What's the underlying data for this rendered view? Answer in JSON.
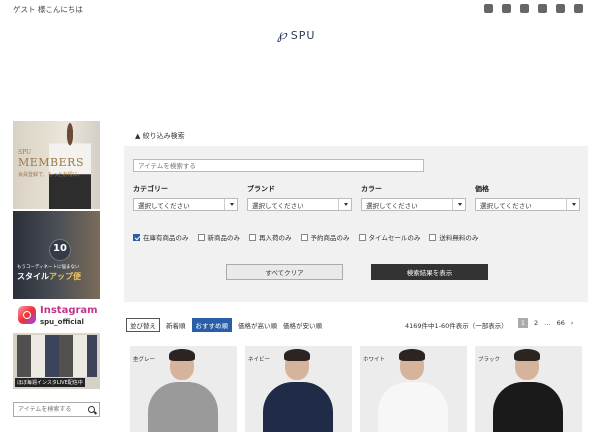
{
  "header": {
    "greeting": "ゲスト 様こんにちは",
    "logo_mark": "℘",
    "logo_text": "SPU",
    "social_icons": [
      "mail-icon",
      "twitter-icon",
      "instagram-icon",
      "line-icon",
      "youtube-icon",
      "facebook-icon"
    ]
  },
  "sidebar": {
    "members": {
      "small": "SPU",
      "title": "MEMBERS",
      "caption": "会員登録で、もっとお得に。"
    },
    "styleup": {
      "number": "10",
      "sub": "もうコーディネートに悩まない",
      "title_pre": "スタイル",
      "title_em": "アップ便"
    },
    "instagram": {
      "title": "Instagram",
      "handle": "spu_official",
      "caption": "ほぼ毎週インスタLIVE配信中"
    },
    "search_placeholder": "アイテムを検索する"
  },
  "filter": {
    "toggle_label": "▲ 絞り込み検索",
    "keyword_placeholder": "アイテムを検索する",
    "groups": [
      {
        "label": "カテゴリー",
        "value": "選択してください"
      },
      {
        "label": "ブランド",
        "value": "選択してください"
      },
      {
        "label": "カラー",
        "value": "選択してください"
      },
      {
        "label": "価格",
        "value": "選択してください"
      }
    ],
    "checkboxes": [
      {
        "label": "在庫有商品のみ",
        "checked": true
      },
      {
        "label": "新商品のみ",
        "checked": false
      },
      {
        "label": "再入荷のみ",
        "checked": false
      },
      {
        "label": "予約商品のみ",
        "checked": false
      },
      {
        "label": "タイムセールのみ",
        "checked": false
      },
      {
        "label": "送料無料のみ",
        "checked": false
      }
    ],
    "clear_label": "すべてクリア",
    "show_label": "検索結果を表示"
  },
  "sort": {
    "label": "並び替え",
    "options": [
      "新着順",
      "おすすめ順",
      "価格が高い順",
      "価格が安い順"
    ],
    "active": "おすすめ順"
  },
  "results": {
    "count_text": "4169件中1-60件表示（一部表示）",
    "pages": [
      "1",
      "2",
      "…",
      "66",
      "›"
    ]
  },
  "products": [
    {
      "color_label": "杢グレー",
      "body_color": "#9a9a9a"
    },
    {
      "color_label": "ネイビー",
      "body_color": "#1f2b47"
    },
    {
      "color_label": "ホワイト",
      "body_color": "#f7f7f7"
    },
    {
      "color_label": "ブラック",
      "body_color": "#1a1a1a"
    }
  ],
  "colors": {
    "accent": "#2a5fa8",
    "dark_button": "#333333",
    "panel_bg": "#f1f1f1"
  }
}
